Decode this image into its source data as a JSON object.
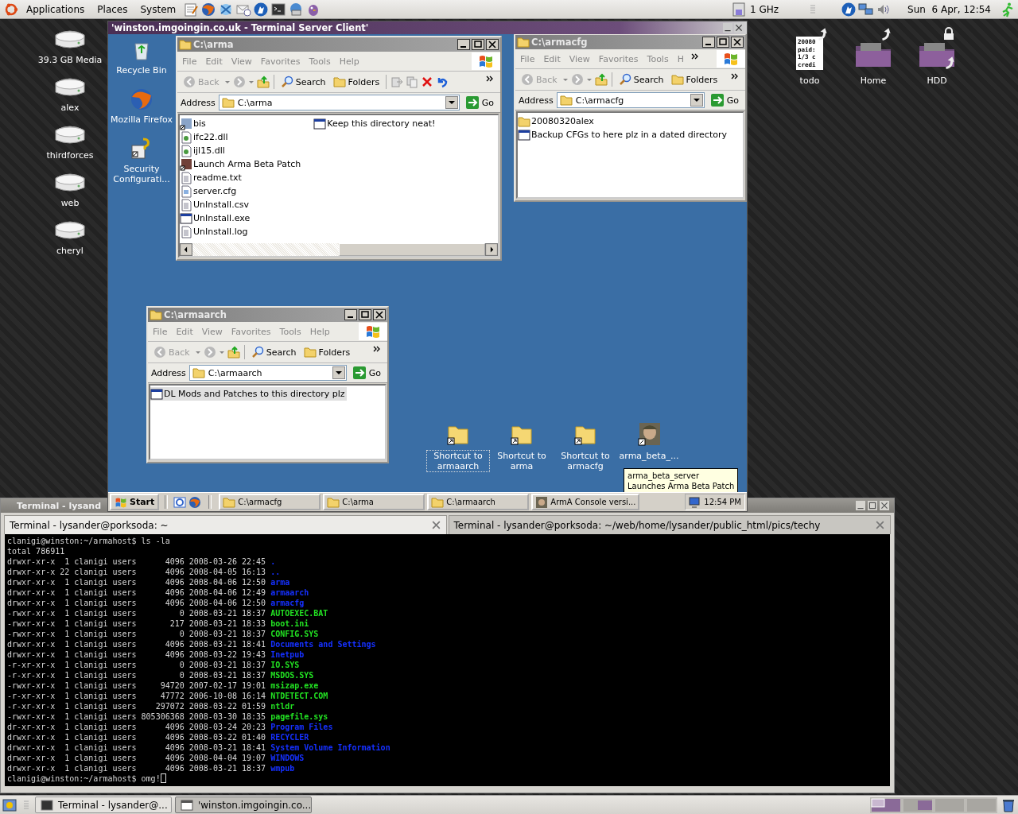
{
  "top_panel": {
    "menus": [
      "Applications",
      "Places",
      "System"
    ],
    "cpu": "1 GHz",
    "clock": "Sun  6 Apr, 12:54"
  },
  "desktop_icons": [
    {
      "label": "39.3 GB Media"
    },
    {
      "label": "alex"
    },
    {
      "label": "thirdforces"
    },
    {
      "label": "web"
    },
    {
      "label": "cheryl"
    }
  ],
  "desktop_icons_right": [
    {
      "label": "todo",
      "kind": "document",
      "preview": [
        "20080",
        "paid:",
        "1/3 c",
        "credi"
      ]
    },
    {
      "label": "Home",
      "kind": "folder"
    },
    {
      "label": "HDD",
      "kind": "locked-folder"
    }
  ],
  "remote_window": {
    "title": "'winston.imgoingin.co.uk - Terminal Server Client'",
    "icons": [
      {
        "label": "Recycle Bin",
        "kind": "recycle"
      },
      {
        "label": "Mozilla Firefox",
        "kind": "browser"
      },
      {
        "label": "Security Configurati...",
        "kind": "security"
      }
    ],
    "explorers": [
      {
        "title": "C:\\arma",
        "menus": [
          "File",
          "Edit",
          "View",
          "Favorites",
          "Tools",
          "Help"
        ],
        "menu_overflow": false,
        "back": "Back",
        "search": "Search",
        "folders": "Folders",
        "extra_tools": true,
        "address_label": "Address",
        "address": "C:\\arma",
        "go": "Go",
        "horizontal_scrollbar": true,
        "files": [
          {
            "name": "bis",
            "kind": "link",
            "selected": false
          },
          {
            "name": "ifc22.dll",
            "kind": "dll",
            "selected": false
          },
          {
            "name": "ijl15.dll",
            "kind": "dll",
            "selected": false
          },
          {
            "name": "Launch Arma Beta Patch",
            "kind": "app-link",
            "selected": false
          },
          {
            "name": "readme.txt",
            "kind": "text",
            "selected": false
          },
          {
            "name": "server.cfg",
            "kind": "cfg",
            "selected": false
          },
          {
            "name": "UnInstall.csv",
            "kind": "text",
            "selected": false
          },
          {
            "name": "UnInstall.exe",
            "kind": "exe",
            "selected": false
          },
          {
            "name": "UnInstall.log",
            "kind": "text",
            "selected": false
          },
          {
            "name": "Keep this directory neat!",
            "kind": "note",
            "selected": false
          }
        ]
      },
      {
        "title": "C:\\armacfg",
        "menus": [
          "File",
          "Edit",
          "View",
          "Favorites",
          "Tools",
          "H"
        ],
        "menu_overflow": true,
        "back": "Back",
        "search": "Search",
        "folders": "Folders",
        "extra_tools": false,
        "address_label": "Address",
        "address": "C:\\armacfg",
        "go": "Go",
        "horizontal_scrollbar": false,
        "files": [
          {
            "name": "20080320alex",
            "kind": "folder",
            "selected": false
          },
          {
            "name": "Backup CFGs to here plz in a dated directory",
            "kind": "note",
            "selected": false
          }
        ]
      },
      {
        "title": "C:\\armaarch",
        "menus": [
          "File",
          "Edit",
          "View",
          "Favorites",
          "Tools",
          "Help"
        ],
        "menu_overflow": false,
        "back": "Back",
        "search": "Search",
        "folders": "Folders",
        "extra_tools": false,
        "address_label": "Address",
        "address": "C:\\armaarch",
        "go": "Go",
        "horizontal_scrollbar": false,
        "files": [
          {
            "name": "DL Mods and Patches to this directory plz",
            "kind": "note",
            "selected": true
          }
        ]
      }
    ],
    "shortcuts": [
      {
        "label": "Shortcut to armaarch",
        "kind": "folder",
        "selected": true
      },
      {
        "label": "Shortcut to arma",
        "kind": "folder",
        "selected": false
      },
      {
        "label": "Shortcut to armacfg",
        "kind": "folder",
        "selected": false
      },
      {
        "label": "arma_beta_...",
        "kind": "soldier",
        "selected": false
      }
    ],
    "tooltip": {
      "title": "arma_beta_server",
      "text": "Launches Arma Beta Patch"
    },
    "start": "Start",
    "tasks": [
      {
        "label": "C:\\armacfg",
        "kind": "folder",
        "selected": false
      },
      {
        "label": "C:\\arma",
        "kind": "folder",
        "selected": false
      },
      {
        "label": "C:\\armaarch",
        "kind": "folder",
        "selected": false
      },
      {
        "label": "ArmA Console versi...",
        "kind": "soldier",
        "selected": false
      }
    ],
    "time": "12:54 PM"
  },
  "terminal": {
    "title": "Terminal - lysand",
    "tabs": [
      {
        "label": "Terminal - lysander@porksoda: ~",
        "selected": true
      },
      {
        "label": "Terminal - lysander@porksoda: ~/web/home/lysander/public_html/pics/techy",
        "selected": false
      }
    ],
    "lines": [
      {
        "kind": "plain",
        "text": "clanigi@winston:~/armahost$ ls -la"
      },
      {
        "kind": "plain",
        "text": "total 786911"
      },
      {
        "kind": "dir",
        "text": "drwxr-xr-x  1 clanigi users      4096 2008-03-26 22:45 ",
        "name": "."
      },
      {
        "kind": "dir",
        "text": "drwxr-xr-x 22 clanigi users      4096 2008-04-05 16:13 ",
        "name": ".."
      },
      {
        "kind": "dir",
        "text": "drwxr-xr-x  1 clanigi users      4096 2008-04-06 12:50 ",
        "name": "arma"
      },
      {
        "kind": "dir",
        "text": "drwxr-xr-x  1 clanigi users      4096 2008-04-06 12:49 ",
        "name": "armaarch"
      },
      {
        "kind": "dir",
        "text": "drwxr-xr-x  1 clanigi users      4096 2008-04-06 12:50 ",
        "name": "armacfg"
      },
      {
        "kind": "exec",
        "text": "-rwxr-xr-x  1 clanigi users         0 2008-03-21 18:37 ",
        "name": "AUTOEXEC.BAT"
      },
      {
        "kind": "exec",
        "text": "-rwxr-xr-x  1 clanigi users       217 2008-03-21 18:33 ",
        "name": "boot.ini"
      },
      {
        "kind": "exec",
        "text": "-rwxr-xr-x  1 clanigi users         0 2008-03-21 18:37 ",
        "name": "CONFIG.SYS"
      },
      {
        "kind": "dir",
        "text": "drwxr-xr-x  1 clanigi users      4096 2008-03-21 18:41 ",
        "name": "Documents and Settings"
      },
      {
        "kind": "dir",
        "text": "drwxr-xr-x  1 clanigi users      4096 2008-03-22 19:43 ",
        "name": "Inetpub"
      },
      {
        "kind": "exec",
        "text": "-r-xr-xr-x  1 clanigi users         0 2008-03-21 18:37 ",
        "name": "IO.SYS"
      },
      {
        "kind": "exec",
        "text": "-r-xr-xr-x  1 clanigi users         0 2008-03-21 18:37 ",
        "name": "MSDOS.SYS"
      },
      {
        "kind": "exec",
        "text": "-rwxr-xr-x  1 clanigi users     94720 2007-02-17 19:01 ",
        "name": "msizap.exe"
      },
      {
        "kind": "exec",
        "text": "-r-xr-xr-x  1 clanigi users     47772 2006-10-08 16:14 ",
        "name": "NTDETECT.COM"
      },
      {
        "kind": "exec",
        "text": "-r-xr-xr-x  1 clanigi users    297072 2008-03-22 01:59 ",
        "name": "ntldr"
      },
      {
        "kind": "exec",
        "text": "-rwxr-xr-x  1 clanigi users 805306368 2008-03-30 18:35 ",
        "name": "pagefile.sys"
      },
      {
        "kind": "dir",
        "text": "dr-xr-xr-x  1 clanigi users      4096 2008-03-24 20:23 ",
        "name": "Program Files"
      },
      {
        "kind": "dir",
        "text": "drwxr-xr-x  1 clanigi users      4096 2008-03-22 01:40 ",
        "name": "RECYCLER"
      },
      {
        "kind": "dir",
        "text": "drwxr-xr-x  1 clanigi users      4096 2008-03-21 18:41 ",
        "name": "System Volume Information"
      },
      {
        "kind": "dir",
        "text": "drwxr-xr-x  1 clanigi users      4096 2008-04-04 19:07 ",
        "name": "WINDOWS"
      },
      {
        "kind": "dir",
        "text": "drwxr-xr-x  1 clanigi users      4096 2008-03-21 18:37 ",
        "name": "wmpub"
      },
      {
        "kind": "prompt",
        "text": "clanigi@winston:~/armahost$ omg!"
      }
    ]
  },
  "bottom_panel": {
    "tasks": [
      {
        "label": "Terminal - lysander@...",
        "kind": "terminal",
        "selected": false
      },
      {
        "label": "'winston.imgoingin.co...",
        "kind": "window",
        "selected": true
      }
    ]
  }
}
